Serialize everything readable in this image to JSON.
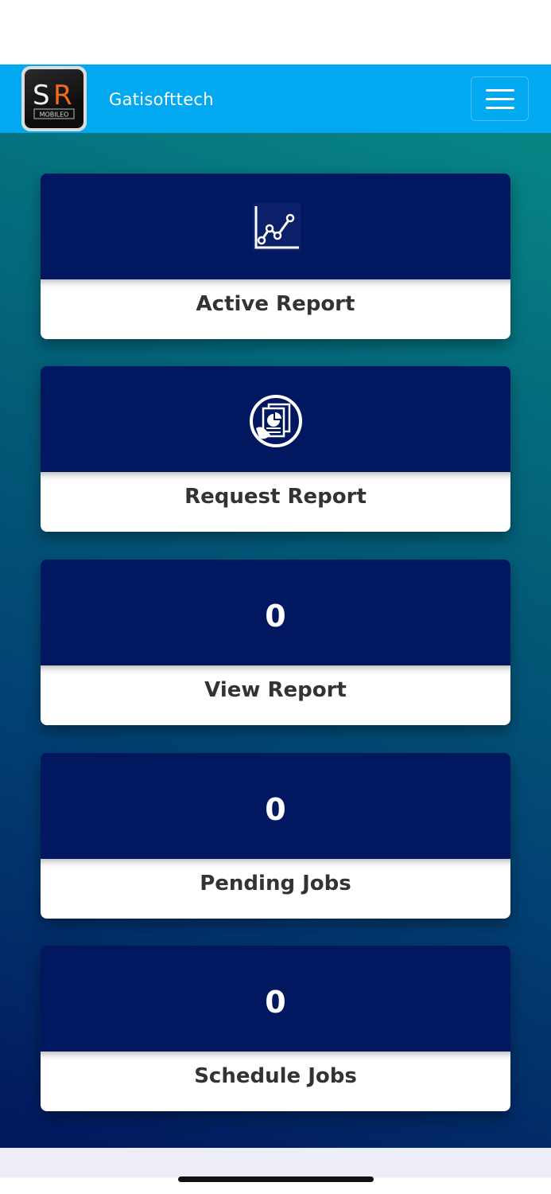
{
  "header": {
    "logo_text_main": "SR",
    "logo_text_sub": "MOBILEO",
    "brand": "Gatisofttech",
    "menu_icon": "hamburger-menu-icon"
  },
  "cards": [
    {
      "label": "Active Report",
      "icon": "line-chart-icon"
    },
    {
      "label": "Request Report",
      "icon": "report-document-icon"
    },
    {
      "label": "View Report",
      "count": "0"
    },
    {
      "label": "Pending Jobs",
      "count": "0"
    },
    {
      "label": "Schedule Jobs",
      "count": "0"
    }
  ],
  "colors": {
    "navbar": "#03a9f0",
    "card_header": "#011760",
    "label_text": "#333333"
  }
}
